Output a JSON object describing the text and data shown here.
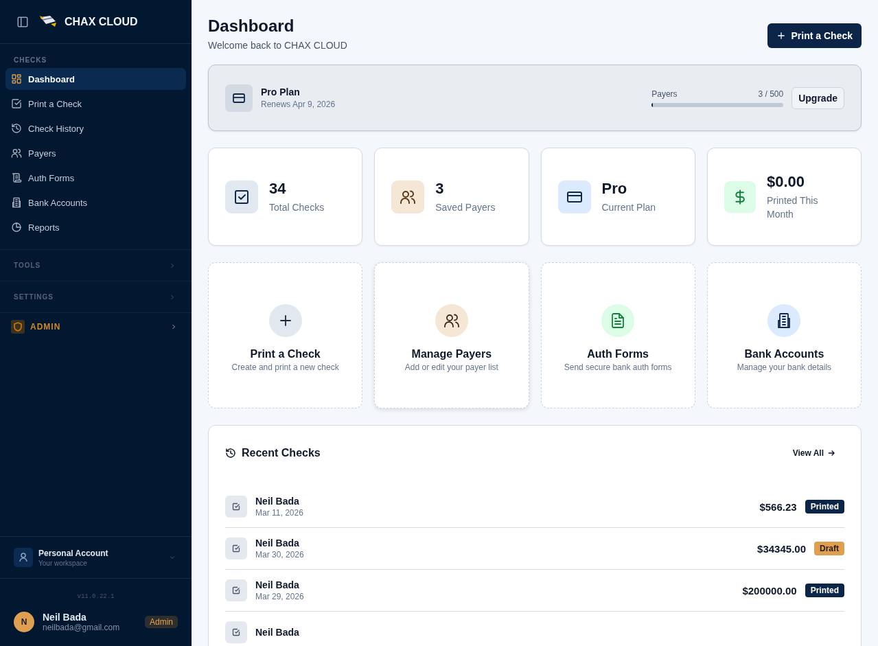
{
  "sidebar": {
    "brand": "CHAX CLOUD",
    "section": "CHECKS",
    "items": [
      {
        "label": "Dashboard",
        "selected": true
      },
      {
        "label": "Print a Check",
        "selected": false
      },
      {
        "label": "Check History",
        "selected": false
      },
      {
        "label": "Payers",
        "selected": false
      },
      {
        "label": "Auth Forms",
        "selected": false
      },
      {
        "label": "Bank Accounts",
        "selected": false
      },
      {
        "label": "Reports",
        "selected": false
      }
    ],
    "groups": [
      {
        "label": "TOOLS",
        "expanded": false
      },
      {
        "label": "SETTINGS",
        "expanded": false
      }
    ],
    "admin": "ADMIN",
    "account": {
      "name": "Personal Account",
      "subtitle": "Your workspace"
    },
    "version": "v11.0.22.1",
    "user": {
      "initial": "N",
      "name": "Neil Bada",
      "email": "neilbada@gmail.com",
      "role": "Admin"
    }
  },
  "header": {
    "title": "Dashboard",
    "subtitle": "Welcome back to CHAX CLOUD",
    "action": "Print a Check"
  },
  "plan": {
    "name": "Pro Plan",
    "renews": "Renews Apr 9, 2026",
    "meter_label": "Payers",
    "reading": "3 / 500",
    "level": 0.006,
    "button": "Upgrade"
  },
  "stats": [
    {
      "value": "34",
      "label": "Total Checks",
      "color": "#e2e8f0"
    },
    {
      "value": "3",
      "label": "Saved Payers",
      "color": "#f5e7d6"
    },
    {
      "value": "Pro",
      "label": "Current Plan",
      "color": "#dbeafe"
    },
    {
      "value": "$0.00",
      "label": "Printed This Month",
      "color": "#dcfce7"
    }
  ],
  "actions": [
    {
      "title": "Print a Check",
      "description": "Create and print a new check",
      "color": "#e2e8f0"
    },
    {
      "title": "Manage Payers",
      "description": "Add or edit your payer list",
      "color": "#f5e7d6"
    },
    {
      "title": "Auth Forms",
      "description": "Send secure bank auth forms",
      "color": "#dcfce7"
    },
    {
      "title": "Bank Accounts",
      "description": "Manage your bank details",
      "color": "#dbeafe"
    }
  ],
  "recent": {
    "title": "Recent Checks",
    "link": "View All",
    "rows": [
      {
        "name": "Neil Bada",
        "date": "Mar 11, 2026",
        "amount": "$566.23",
        "status": "Printed",
        "kind": "printed"
      },
      {
        "name": "Neil Bada",
        "date": "Mar 30, 2026",
        "amount": "$34345.00",
        "status": "Draft",
        "kind": "draft"
      },
      {
        "name": "Neil Bada",
        "date": "Mar 29, 2026",
        "amount": "$200000.00",
        "status": "Printed",
        "kind": "printed"
      },
      {
        "name": "Neil Bada"
      }
    ]
  }
}
